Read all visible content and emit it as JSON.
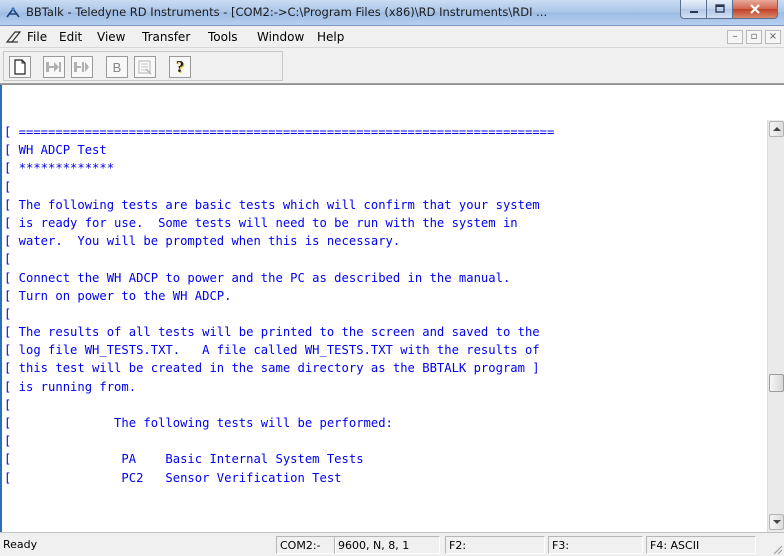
{
  "window": {
    "title": "BBTalk - Teledyne RD Instruments - [COM2:->C:\\Program Files (x86)\\RD Instruments\\RDI ..."
  },
  "menu": {
    "items": [
      "File",
      "Edit",
      "View",
      "Transfer",
      "Tools",
      "Window",
      "Help"
    ]
  },
  "toolbar": {
    "buttons": [
      "new-document-icon",
      "connect-icon",
      "disconnect-icon",
      "break-icon",
      "properties-icon",
      "help-icon"
    ],
    "break_label": "B",
    "help_label": "?"
  },
  "terminal": {
    "lines": [
      "[ =========================================================================",
      "[ WH ADCP Test",
      "[ *************",
      "[",
      "[ The following tests are basic tests which will confirm that your system",
      "[ is ready for use.  Some tests will need to be run with the system in",
      "[ water.  You will be prompted when this is necessary.",
      "[",
      "[ Connect the WH ADCP to power and the PC as described in the manual.",
      "[ Turn on power to the WH ADCP.",
      "[",
      "[ The results of all tests will be printed to the screen and saved to the",
      "[ log file WH_TESTS.TXT.   A file called WH_TESTS.TXT with the results of",
      "[ this test will be created in the same directory as the BBTALK program ]",
      "[ is running from.",
      "[",
      "[              The following tests will be performed:",
      "[",
      "[               PA    Basic Internal System Tests",
      "[               PC2   Sensor Verification Test"
    ]
  },
  "statusbar": {
    "status": "Ready",
    "port": "COM2:-",
    "settings": "9600, N, 8, 1",
    "f2": "F2:",
    "f3": "F3:",
    "f4": "F4: ASCII"
  },
  "colors": {
    "terminal_text": "#0000ee",
    "close_button": "#c0402a"
  }
}
